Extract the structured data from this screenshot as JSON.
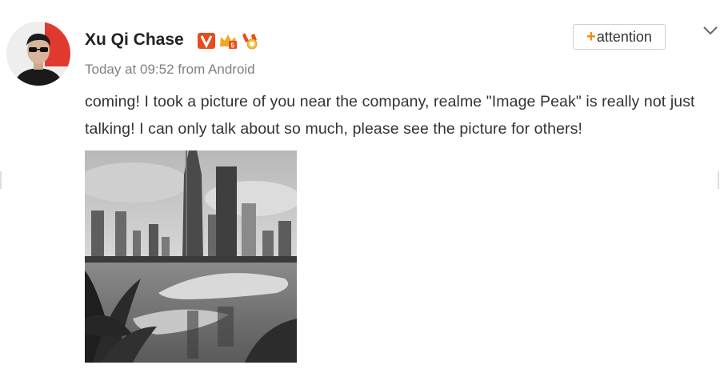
{
  "post": {
    "author": "Xu Qi Chase",
    "badges": [
      "verified-v-icon",
      "vip-crown-icon",
      "medal-icon"
    ],
    "meta": "Today at 09:52 from Android",
    "follow": {
      "plus": "+",
      "label": "attention"
    },
    "menu_icon": "chevron-down-icon",
    "text": "coming! I took a picture of you near the company, realme \"Image Peak\" is really not just talking! I can only talk about so much, please see the picture for others!",
    "image_style": "grayscale city skyline with skyscrapers, river and palm leaves"
  },
  "colors": {
    "accent": "#ff8200",
    "verified": "#e84c1e",
    "meta_text": "#808080",
    "body_text": "#333333"
  }
}
